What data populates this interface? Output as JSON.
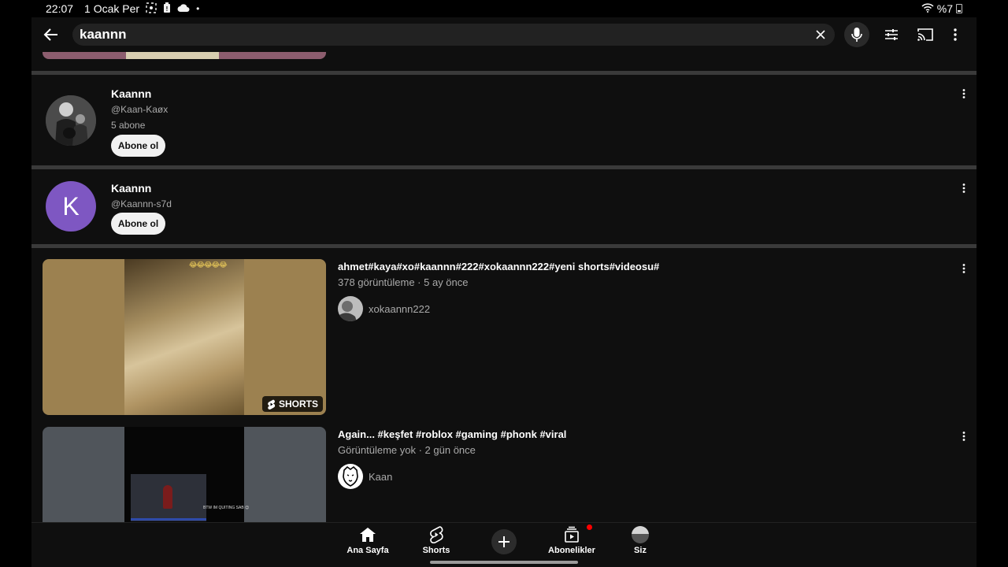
{
  "status_bar": {
    "time": "22:07",
    "date": "1 Ocak Per",
    "battery": "%7",
    "icons": [
      "screenshot-icon",
      "battery-saver-icon",
      "cloud-icon",
      "dot-icon",
      "wifi-icon",
      "battery-icon"
    ]
  },
  "search": {
    "query": "kaannn",
    "icons": [
      "back-arrow-icon",
      "clear-icon",
      "mic-icon",
      "filter-icon",
      "cast-icon",
      "more-vertical-icon"
    ]
  },
  "channels": [
    {
      "name": "Kaannn",
      "handle": "@Kaan-Kaøx",
      "subscribers": "5 abone",
      "subscribe_label": "Abone ol",
      "avatar_type": "photo"
    },
    {
      "name": "Kaannn",
      "handle": "@Kaannn-s7d",
      "subscribe_label": "Abone ol",
      "avatar_letter": "K",
      "avatar_color": "#7e57c2"
    }
  ],
  "videos": [
    {
      "title": "ahmet#kaya#xo#kaannn#222#xokaannn222#yeni shorts#videosu#",
      "meta": "378 görüntüleme · 5 ay önce",
      "channel": "xokaannn222",
      "badge": "SHORTS",
      "thumb_emoji": "😂😂😂😂😂"
    },
    {
      "title": "Again... #keşfet #roblox #gaming #phonk #viral",
      "meta": "Görüntüleme yok · 2 gün önce",
      "channel": "Kaan",
      "thumb_caption": "BTW IM QUITING SAB 😊"
    }
  ],
  "nav": {
    "home": "Ana Sayfa",
    "shorts": "Shorts",
    "subscriptions": "Abonelikler",
    "you": "Siz"
  },
  "colors": {
    "background": "#0f0f0f",
    "accent_red": "#ff0000",
    "avatar_purple": "#7e57c2"
  }
}
